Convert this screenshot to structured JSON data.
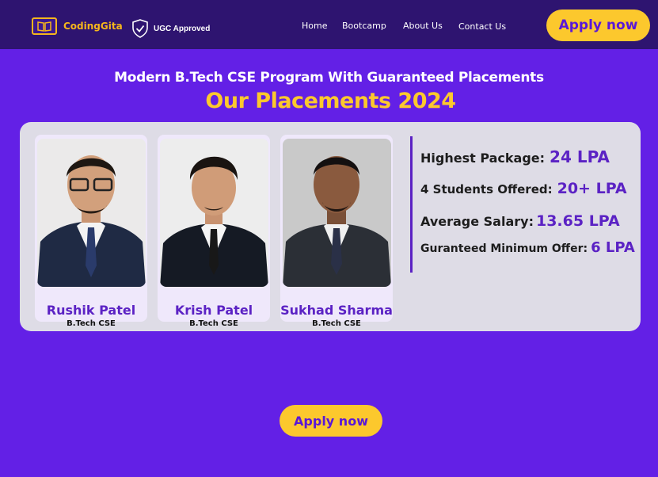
{
  "nav": {
    "brand": "CodingGita",
    "ugc": "UGC Approved",
    "links": [
      "Home",
      "Bootcamp",
      "About Us",
      "Contact Us"
    ],
    "apply": "Apply now"
  },
  "hero": {
    "subtitle": "Modern B.Tech CSE Program With Guaranteed Placements",
    "title": "Our Placements 2024"
  },
  "students": [
    {
      "name": "Rushik Patel",
      "degree": "B.Tech CSE"
    },
    {
      "name": "Krish Patel",
      "degree": "B.Tech CSE"
    },
    {
      "name": "Sukhad Sharma",
      "degree": "B.Tech CSE"
    }
  ],
  "stats": [
    {
      "label": "Highest Package:",
      "value": "24 LPA"
    },
    {
      "label": "4 Students Offered:",
      "value": "20+ LPA"
    },
    {
      "label": "Average Salary:",
      "value": "13.65 LPA"
    },
    {
      "label": "Guranteed Minimum Offer:",
      "value": "6 LPA"
    }
  ],
  "cta": {
    "label": "Apply now"
  },
  "colors": {
    "background": "#6320e6",
    "navbar": "#2e1470",
    "accent": "#fcc82d",
    "purple_text": "#5b22c4"
  }
}
